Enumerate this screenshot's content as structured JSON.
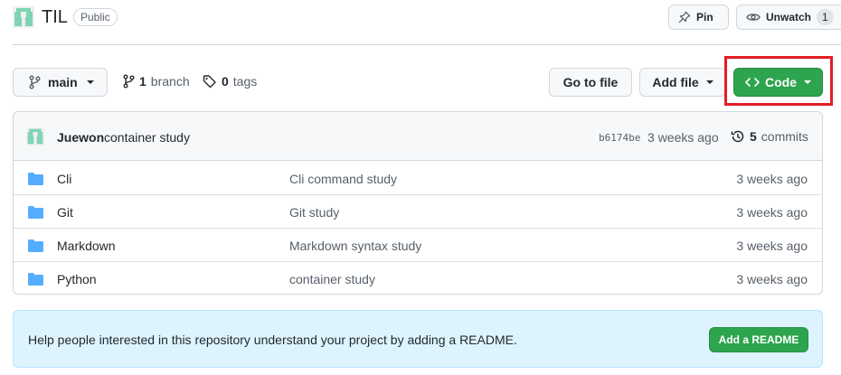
{
  "repo": {
    "name": "TIL",
    "visibility": "Public",
    "avatar_color": "#7ed4b4"
  },
  "header_actions": {
    "pin_label": "Pin",
    "unwatch_label": "Unwatch",
    "watch_count": "1"
  },
  "toolbar": {
    "branch_name": "main",
    "branch_count": "1",
    "branch_label": "branch",
    "tag_count": "0",
    "tag_label": "tags",
    "goto_file_label": "Go to file",
    "add_file_label": "Add file",
    "code_label": "Code",
    "code_color": "#2da44e",
    "highlight_color": "#e41d25"
  },
  "latest_commit": {
    "author": "Juewon",
    "message": "container study",
    "sha": "b6174be",
    "time": "3 weeks ago",
    "commit_count": "5",
    "commit_label": "commits"
  },
  "files": [
    {
      "name": "Cli",
      "message": "Cli command study",
      "time": "3 weeks ago",
      "icon": "folder-icon"
    },
    {
      "name": "Git",
      "message": "Git study",
      "time": "3 weeks ago",
      "icon": "folder-icon"
    },
    {
      "name": "Markdown",
      "message": "Markdown syntax study",
      "time": "3 weeks ago",
      "icon": "folder-icon"
    },
    {
      "name": "Python",
      "message": "container study",
      "time": "3 weeks ago",
      "icon": "folder-icon"
    }
  ],
  "readme": {
    "prompt": "Help people interested in this repository understand your project by adding a README.",
    "button_label": "Add a README",
    "background": "#ddf4ff"
  }
}
